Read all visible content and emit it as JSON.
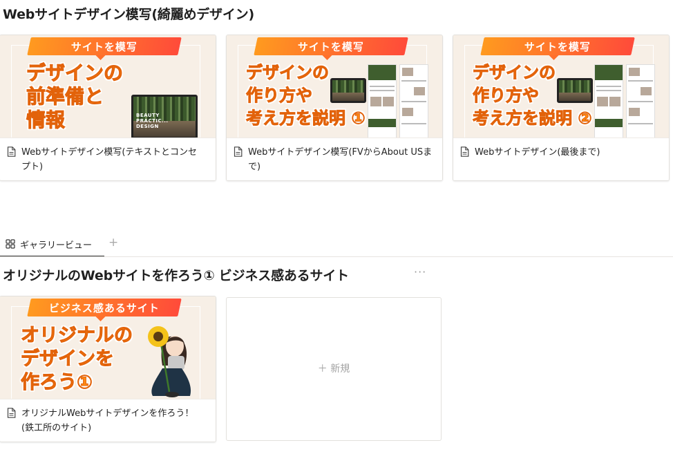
{
  "section1": {
    "title": "Webサイトデザイン模写(綺麗めデザイン)",
    "cards": [
      {
        "ribbon": "サイトを模写",
        "cover_lines": [
          "デザインの",
          "前準備と",
          "情報"
        ],
        "screen_text": [
          "BEAUTY",
          "PRACTIC...",
          "DESIGN"
        ],
        "title": "Webサイトデザイン模写(テキストとコンセプト)"
      },
      {
        "ribbon": "サイトを模写",
        "cover_lines": [
          "デザインの",
          "作り方や",
          "考え方を説明 ①"
        ],
        "title": "Webサイトデザイン模写(FVからAbout USまで)"
      },
      {
        "ribbon": "サイトを模写",
        "cover_lines": [
          "デザインの",
          "作り方や",
          "考え方を説明 ②"
        ],
        "title": "Webサイトデザイン(最後まで)"
      }
    ]
  },
  "view_tabs": [
    {
      "label": "ギャラリービュー",
      "icon": "gallery-grid-icon"
    }
  ],
  "add_view_glyph": "+",
  "section2": {
    "title": "オリジナルのWebサイトを作ろう① ビジネス感あるサイト",
    "more_glyph": "···",
    "cards": [
      {
        "ribbon": "ビジネス感あるサイト",
        "cover_lines": [
          "オリジナルの",
          "デザインを",
          "作ろう①"
        ],
        "title": "オリジナルWebサイトデザインを作ろう！(鉄工所のサイト)"
      }
    ],
    "new_label": "＋ 新規"
  },
  "colors": {
    "accent_orange": "#ff8a14",
    "ribbon_start": "#ff9a1f",
    "ribbon_end": "#ff4b3a",
    "cover_bg": "#f7efe6"
  }
}
